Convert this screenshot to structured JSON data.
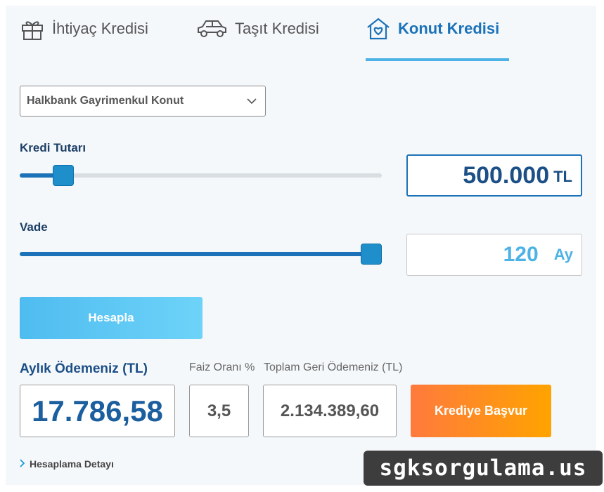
{
  "tabs": [
    {
      "label": "İhtiyaç Kredisi",
      "icon": "gift-icon",
      "active": false
    },
    {
      "label": "Taşıt Kredisi",
      "icon": "car-icon",
      "active": false
    },
    {
      "label": "Konut Kredisi",
      "icon": "house-heart-icon",
      "active": true
    }
  ],
  "product_select": {
    "value": "Halkbank Gayrimenkul Konut"
  },
  "loan_amount": {
    "label": "Kredi Tutarı",
    "value": "500.000",
    "unit": "TL",
    "slider_fraction": 0.12
  },
  "term": {
    "label": "Vade",
    "value": "120",
    "unit": "Ay",
    "slider_fraction": 0.97
  },
  "calculate_label": "Hesapla",
  "results": {
    "monthly_label": "Aylık Ödemeniz (TL)",
    "monthly_value": "17.786,58",
    "rate_label": "Faiz Oranı %",
    "rate_value": "3,5",
    "total_label": "Toplam Geri Ödemeniz (TL)",
    "total_value": "2.134.389,60"
  },
  "apply_label": "Krediye Başvur",
  "detail_link": "Hesaplama Detayı",
  "watermark": "sgksorgulama.us",
  "colors": {
    "primary": "#1b72b8",
    "accent_light": "#4db2e6",
    "apply_gradient_start": "#ff7a3d",
    "apply_gradient_end": "#ffa300"
  }
}
